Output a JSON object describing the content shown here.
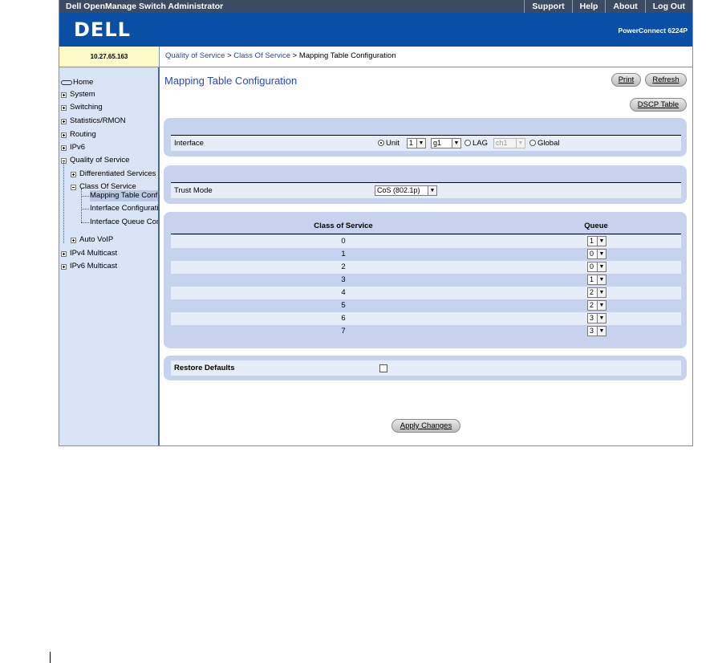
{
  "window": {
    "app_title": "Dell OpenManage Switch Administrator",
    "nav_links": [
      "Support",
      "Help",
      "About",
      "Log Out"
    ],
    "brand": "DELL",
    "model": "PowerConnect 6224P"
  },
  "ip_address": "10.27.65.163",
  "breadcrumb": {
    "crumb1": "Quality of Service",
    "sep1": " > ",
    "crumb2": "Class Of Service",
    "sep2": " > ",
    "current": "Mapping Table Configuration"
  },
  "sidebar": {
    "home": "Home",
    "system": "System",
    "switching": "Switching",
    "statistics": "Statistics/RMON",
    "routing": "Routing",
    "ipv6": "IPv6",
    "qos": "Quality of Service",
    "diffserv": "Differentiated Services",
    "cos": "Class Of Service",
    "mapping": "Mapping Table Configuration",
    "interface_config": "Interface Configuration",
    "interface_queue": "Interface Queue Configuration",
    "autovoip": "Auto VoIP",
    "ipv4mc": "IPv4 Multicast",
    "ipv6mc": "IPv6 Multicast"
  },
  "page": {
    "title": "Mapping Table Configuration",
    "print_label": "Print",
    "refresh_label": "Refresh",
    "dscp_label": "DSCP Table",
    "apply_label": "Apply Changes"
  },
  "interface": {
    "label": "Interface",
    "unit_label": "Unit",
    "unit_value": "1",
    "port_value": "g1",
    "lag_label": "LAG",
    "lag_value": "ch1",
    "global_label": "Global",
    "selected": "Unit"
  },
  "trust_mode": {
    "label": "Trust Mode",
    "value": "CoS (802.1p)"
  },
  "mapping_table": {
    "col_cos": "Class of Service",
    "col_queue": "Queue",
    "rows": [
      {
        "cos": "0",
        "queue": "1"
      },
      {
        "cos": "1",
        "queue": "0"
      },
      {
        "cos": "2",
        "queue": "0"
      },
      {
        "cos": "3",
        "queue": "1"
      },
      {
        "cos": "4",
        "queue": "2"
      },
      {
        "cos": "5",
        "queue": "2"
      },
      {
        "cos": "6",
        "queue": "3"
      },
      {
        "cos": "7",
        "queue": "3"
      }
    ]
  },
  "restore_defaults": {
    "label": "Restore Defaults",
    "checked": false
  },
  "colors": {
    "title_bar": "#3c4a62",
    "brand_bar": "#0a4fa6",
    "panel": "#c7d3ee",
    "sidebar": "#d9e4f6",
    "link": "#2a48b8"
  }
}
